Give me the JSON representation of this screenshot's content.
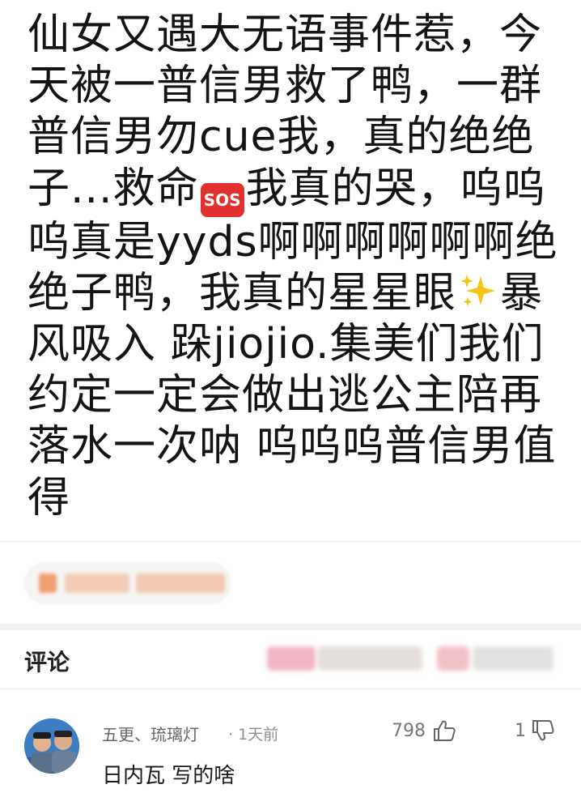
{
  "post": {
    "line1": "仙女又遇大无语事件惹，今",
    "line2": "天被一普信男救了鸭，一群",
    "line3": "普信男勿cue我，真的绝绝",
    "line4_a": "子...救命",
    "line4_b": "我真的哭，呜呜",
    "line5": "呜真是yyds啊啊啊啊啊啊绝",
    "line6_a": "绝子鸭，我真的星星眼",
    "line6_b": "暴",
    "line7": "风吸入 跺jiojio.集美们我们",
    "line8": "约定一定会做出逃公主陪再",
    "line9": "落水一次呐 呜呜呜普信男值",
    "line10": "得",
    "sos_emoji_text": "SOS",
    "sparkles_icon": "sparkles-icon"
  },
  "comments_section": {
    "title": "评论"
  },
  "comment": {
    "user": "五更、琉璃灯",
    "time": "· 1天前",
    "text": "日内瓦 写的啥",
    "likes": "798",
    "dislikes": "1",
    "like_icon": "thumbs-up-icon",
    "dislike_icon": "thumbs-down-icon"
  },
  "colors": {
    "sos_red": "#e0312f",
    "sparkle_yellow": "#f5c518",
    "section_gap": "#f3f3f3"
  }
}
